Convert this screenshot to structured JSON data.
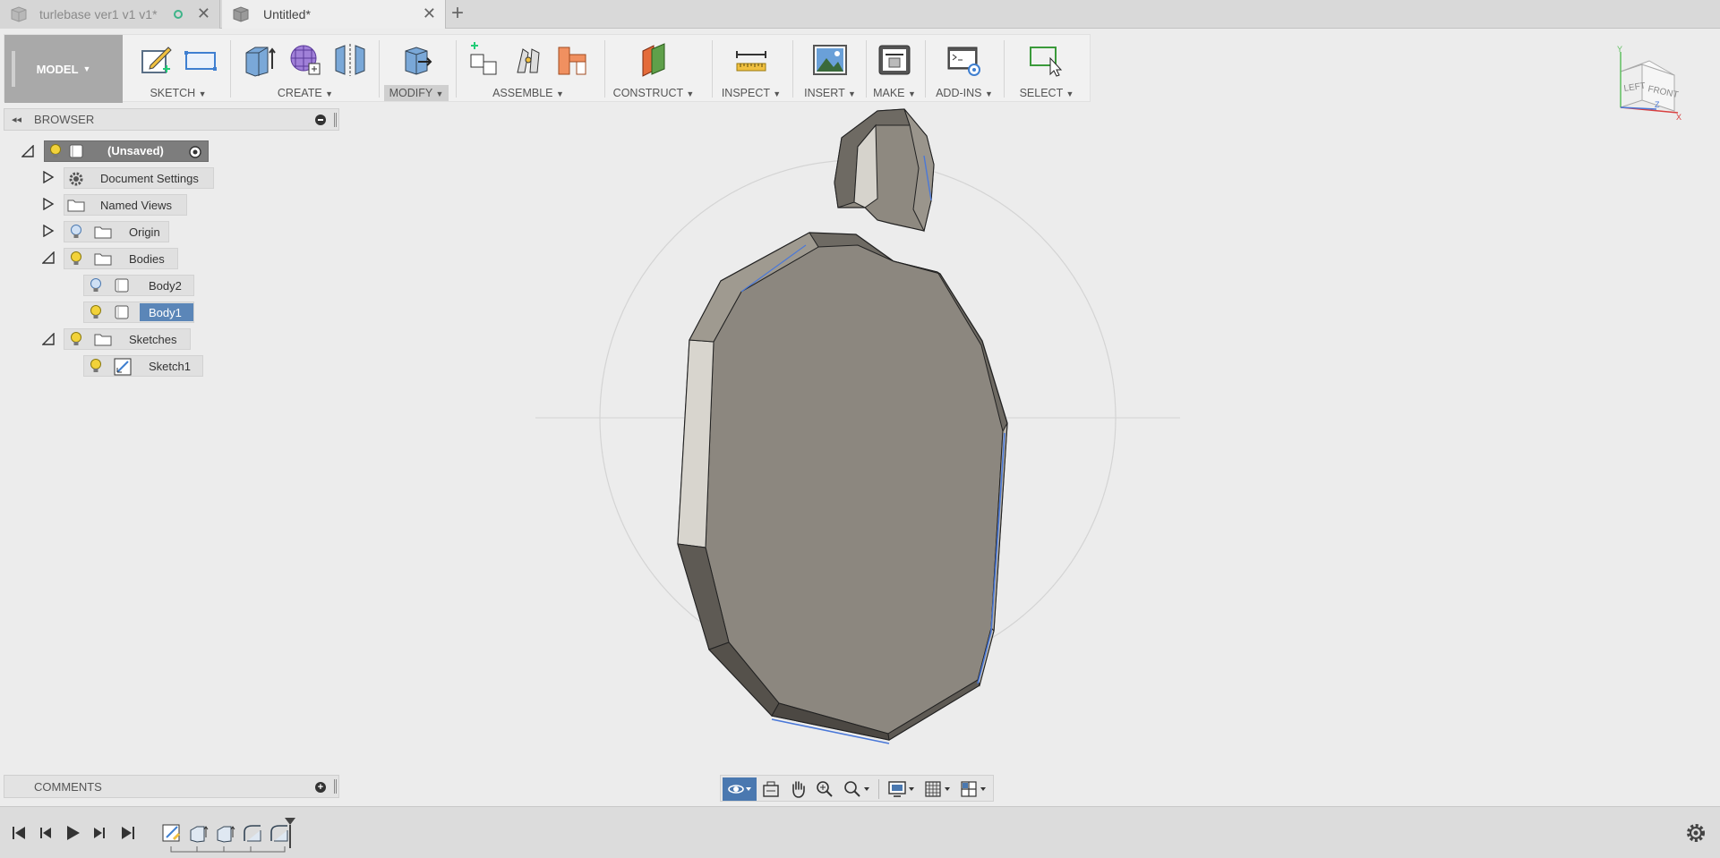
{
  "tabs": [
    {
      "title": "turlebase ver1 v1 v1*",
      "state": "inactive",
      "synced_indicator": "circle-icon"
    },
    {
      "title": "Untitled*",
      "state": "active"
    }
  ],
  "toolbar": {
    "workspace": "MODEL",
    "groups": [
      {
        "label": "SKETCH",
        "icons": [
          "create-sketch-icon",
          "rectangle-icon"
        ]
      },
      {
        "label": "CREATE",
        "icons": [
          "extrude-icon",
          "form-icon",
          "mirror-icon"
        ]
      },
      {
        "label": "MODIFY",
        "icons": [
          "press-pull-icon"
        ],
        "highlighted": true
      },
      {
        "label": "ASSEMBLE",
        "icons": [
          "new-component-icon",
          "joint-icon",
          "as-built-joint-icon"
        ]
      },
      {
        "label": "CONSTRUCT",
        "icons": [
          "offset-plane-icon"
        ]
      },
      {
        "label": "INSPECT",
        "icons": [
          "measure-icon"
        ]
      },
      {
        "label": "INSERT",
        "icons": [
          "insert-image-icon"
        ]
      },
      {
        "label": "MAKE",
        "icons": [
          "3d-print-icon"
        ]
      },
      {
        "label": "ADD-INS",
        "icons": [
          "scripts-icon"
        ]
      },
      {
        "label": "SELECT",
        "icons": [
          "select-icon"
        ]
      }
    ]
  },
  "browser": {
    "title": "BROWSER",
    "root": "(Unsaved)",
    "items": [
      {
        "label": "Document Settings",
        "icon": "gear-icon"
      },
      {
        "label": "Named Views",
        "icon": "folder-icon"
      },
      {
        "label": "Origin",
        "icon": "folder-icon"
      },
      {
        "label": "Bodies",
        "icon": "folder-icon"
      },
      {
        "label": "Body2",
        "icon": "body-icon"
      },
      {
        "label": "Body1",
        "icon": "body-icon",
        "selected": true
      },
      {
        "label": "Sketches",
        "icon": "folder-icon"
      },
      {
        "label": "Sketch1",
        "icon": "sketch-icon"
      }
    ]
  },
  "comments": {
    "title": "COMMENTS"
  },
  "viewcube": {
    "faces": [
      "LEFT",
      "FRONT"
    ],
    "axes": [
      "Y",
      "Z",
      "X"
    ]
  },
  "navbar": {
    "tools": [
      "orbit-icon",
      "look-at-icon",
      "pan-icon",
      "zoom-icon",
      "zoom-window-icon",
      "display-settings-icon",
      "grid-icon",
      "viewports-icon"
    ]
  },
  "timeline": {
    "controls": [
      "go-to-start-icon",
      "step-back-icon",
      "play-icon",
      "step-forward-icon",
      "go-to-end-icon"
    ],
    "features": [
      "sketch-feature-icon",
      "extrude-feature-icon",
      "extrude-feature-icon",
      "fillet-feature-icon",
      "fillet-feature-icon"
    ]
  },
  "colors": {
    "selection": "#5b86b8",
    "accent": "#4a78b0",
    "model": "#8c877f"
  }
}
